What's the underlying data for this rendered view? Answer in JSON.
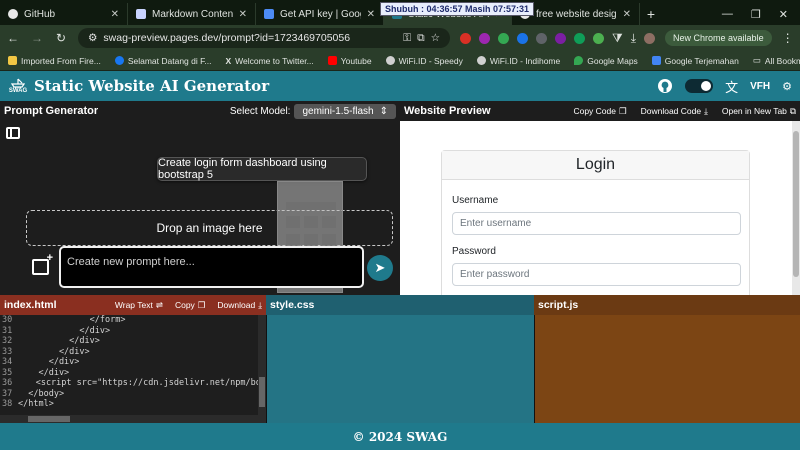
{
  "browser": {
    "tabs": [
      {
        "title": "GitHub",
        "color": "#e8e8e8"
      },
      {
        "title": "Markdown Content Improv",
        "color": "#c9d4ff"
      },
      {
        "title": "Get API key | Google AI S",
        "color": "#4c8bf5"
      },
      {
        "title": "Static Website AI Generator",
        "color": "#1f7a8c"
      },
      {
        "title": "free website design - Pene",
        "color": "#e8e8e8"
      }
    ],
    "clock_text": "Shubuh : 04:36:57  Masih 07:57:31",
    "url": "swag-preview.pages.dev/prompt?id=1723469705056",
    "new_chrome_label": "New Chrome available",
    "bookmarks": [
      {
        "label": "Imported From Fire...",
        "color": "#f2c744"
      },
      {
        "label": "Selamat Datang di F...",
        "color": "#1877f2"
      },
      {
        "label": "Welcome to Twitter...",
        "color": "#ffffff"
      },
      {
        "label": "Youtube",
        "color": "#ff0000"
      },
      {
        "label": "WiFi.ID - Speedy",
        "color": "#d0d0d0"
      },
      {
        "label": "WiFi.ID - Indihome",
        "color": "#d0d0d0"
      },
      {
        "label": "Google Maps",
        "color": "#34a853"
      },
      {
        "label": "Google Terjemahan",
        "color": "#4285f4"
      }
    ],
    "all_bookmarks_label": "All Bookmarks"
  },
  "app": {
    "logo_text": "SWAG",
    "title": "Static Website AI Generator",
    "language_label": "VFH",
    "accent": "#1f7a8c"
  },
  "prompt_panel": {
    "title": "Prompt Generator",
    "model_label": "Select Model:",
    "model_value": "gemini-1.5-flash",
    "suggestion": "Create login form dashboard using bootstrap 5",
    "drop_label": "Drop an image here",
    "input_placeholder": "Create new prompt here..."
  },
  "preview_panel": {
    "title": "Website Preview",
    "copy_code": "Copy Code",
    "download_code": "Download Code",
    "open_new_tab": "Open in New Tab",
    "login_title": "Login",
    "username_label": "Username",
    "username_placeholder": "Enter username",
    "password_label": "Password",
    "password_placeholder": "Enter password"
  },
  "editors": {
    "html": {
      "title": "index.html",
      "wrap_text": "Wrap Text",
      "copy": "Copy",
      "download": "Download",
      "lines": [
        {
          "n": "30",
          "code": "              </form>"
        },
        {
          "n": "31",
          "code": "            </div>"
        },
        {
          "n": "32",
          "code": "          </div>"
        },
        {
          "n": "33",
          "code": "        </div>"
        },
        {
          "n": "34",
          "code": "      </div>"
        },
        {
          "n": "35",
          "code": "    </div>"
        },
        {
          "n": "36",
          "code": "    <script src=\"https://cdn.jsdelivr.net/npm/boo"
        },
        {
          "n": "37",
          "code": "  </body>"
        },
        {
          "n": "38",
          "code": "</html>"
        }
      ]
    },
    "css": {
      "title": "style.css"
    },
    "js": {
      "title": "script.js"
    }
  },
  "footer": {
    "text": "© 2024 SWAG"
  }
}
